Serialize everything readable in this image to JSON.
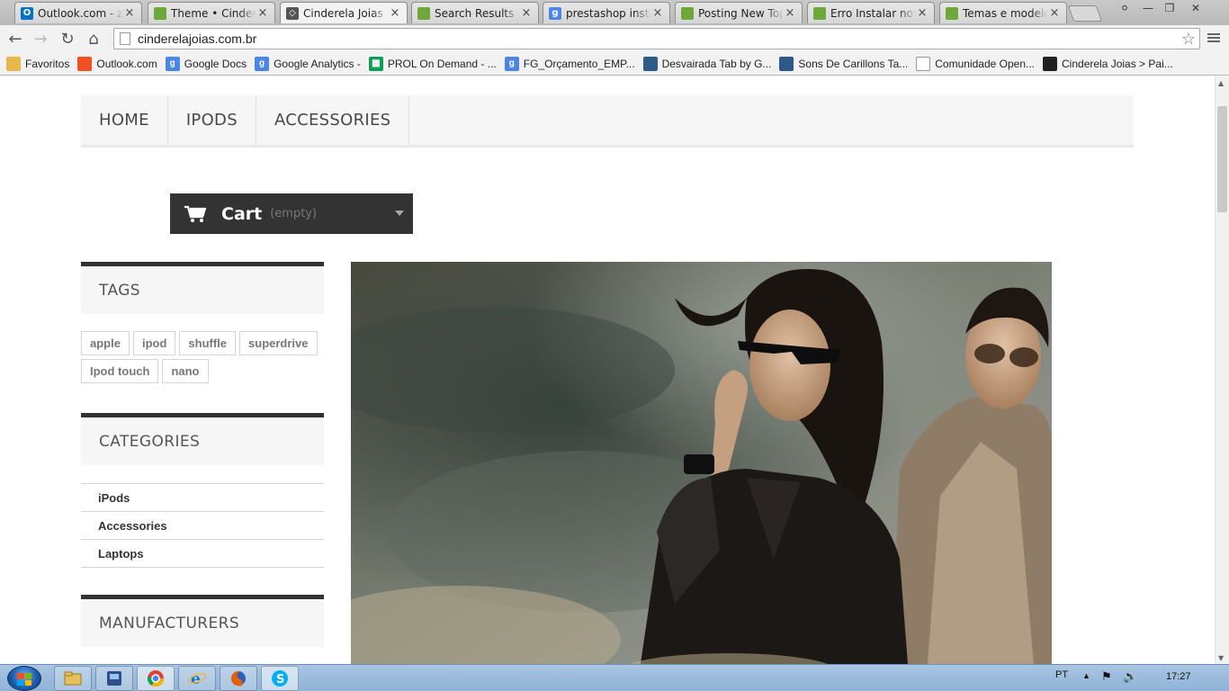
{
  "browser": {
    "tabs": [
      {
        "title": "Outlook.com - ze",
        "icon": "outlook-icon",
        "color": "#0072c6",
        "glyph": "O"
      },
      {
        "title": "Theme • Cinderel",
        "icon": "prestashop-icon",
        "color": "#6fa83a",
        "glyph": ""
      },
      {
        "title": "Cinderela Joias",
        "icon": "diamond-icon",
        "color": "#555555",
        "glyph": "◇"
      },
      {
        "title": "Search Results - P",
        "icon": "prestashop-icon",
        "color": "#6fa83a",
        "glyph": ""
      },
      {
        "title": "prestashop instal",
        "icon": "google-icon",
        "color": "#4a86e8",
        "glyph": "g"
      },
      {
        "title": "Posting New Top",
        "icon": "prestashop-icon",
        "color": "#6fa83a",
        "glyph": ""
      },
      {
        "title": "Erro Instalar novo",
        "icon": "prestashop-icon",
        "color": "#6fa83a",
        "glyph": ""
      },
      {
        "title": "Temas e modelos",
        "icon": "prestashop-icon",
        "color": "#6fa83a",
        "glyph": ""
      }
    ],
    "url": "cinderelajoias.com.br",
    "bookmarks": [
      {
        "label": "Favoritos",
        "icon": "folder-icon",
        "color": "#e8b84a",
        "glyph": ""
      },
      {
        "label": "Outlook.com",
        "icon": "windows-icon",
        "color": "#f25022",
        "glyph": ""
      },
      {
        "label": "Google Docs",
        "icon": "google-icon",
        "color": "#4a86e8",
        "glyph": "g"
      },
      {
        "label": "Google Analytics -",
        "icon": "google-icon",
        "color": "#4a86e8",
        "glyph": "g"
      },
      {
        "label": "PROL On Demand - ...",
        "icon": "sheet-icon",
        "color": "#0f9d58",
        "glyph": "▦"
      },
      {
        "label": "FG_Orçamento_EMP...",
        "icon": "google-icon",
        "color": "#4a86e8",
        "glyph": "g"
      },
      {
        "label": "Desvairada Tab by G...",
        "icon": "image-icon",
        "color": "#2e5a8a",
        "glyph": ""
      },
      {
        "label": "Sons De Carillons Ta...",
        "icon": "image-icon",
        "color": "#2e5a8a",
        "glyph": ""
      },
      {
        "label": "Comunidade Open...",
        "icon": "page-icon",
        "color": "#ffffff",
        "glyph": ""
      },
      {
        "label": "Cinderela Joias > Pai...",
        "icon": "shop-icon",
        "color": "#222222",
        "glyph": ""
      }
    ]
  },
  "site": {
    "menu": [
      "HOME",
      "IPODS",
      "ACCESSORIES"
    ],
    "cart": {
      "label": "Cart",
      "status": "(empty)"
    },
    "tags_title": "TAGS",
    "tags": [
      "apple",
      "ipod",
      "shuffle",
      "superdrive",
      "Ipod touch",
      "nano"
    ],
    "categories_title": "CATEGORIES",
    "categories": [
      "iPods",
      "Accessories",
      "Laptops"
    ],
    "manufacturers_title": "MANUFACTURERS"
  },
  "taskbar": {
    "language": "PT",
    "time": "17:27"
  }
}
